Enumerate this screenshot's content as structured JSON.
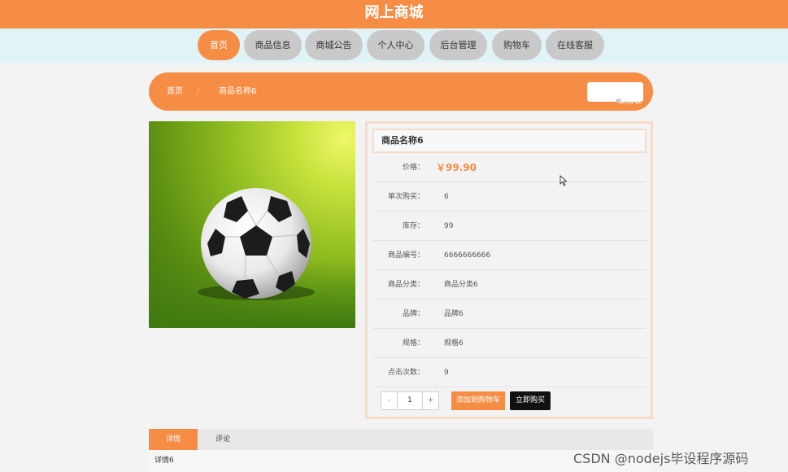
{
  "site": {
    "title": "网上商城"
  },
  "nav": [
    {
      "label": "首页",
      "active": true
    },
    {
      "label": "商品信息"
    },
    {
      "label": "商城公告"
    },
    {
      "label": "个人中心"
    },
    {
      "label": "后台管理"
    },
    {
      "label": "购物车"
    },
    {
      "label": "在线客服"
    }
  ],
  "breadcrumb": {
    "home": "首页",
    "separator": "/",
    "current": "商品名称6"
  },
  "favorite": {
    "label": "取消收藏",
    "icon": "star-icon"
  },
  "product": {
    "name": "商品名称6",
    "image": "soccer-ball",
    "fields": [
      {
        "label": "价格：",
        "value": "￥99.90"
      },
      {
        "label": "单次购买：",
        "value": "6"
      },
      {
        "label": "库存：",
        "value": "99"
      },
      {
        "label": "商品编号：",
        "value": "6666666666"
      },
      {
        "label": "商品分类：",
        "value": "商品分类6"
      },
      {
        "label": "品牌：",
        "value": "品牌6"
      },
      {
        "label": "规格：",
        "value": "规格6"
      },
      {
        "label": "点击次数：",
        "value": "9"
      }
    ]
  },
  "quantity": {
    "minus": "-",
    "value": "1",
    "plus": "+"
  },
  "actions": {
    "add_to_cart": "添加到购物车",
    "buy_now": "立即购买"
  },
  "tabs": [
    {
      "label": "详情",
      "active": true
    },
    {
      "label": "评论"
    }
  ],
  "detail_text": "详情6",
  "watermark": "CSDN @nodejs毕设程序源码",
  "colors": {
    "accent": "#f68d44",
    "nav_bg": "#e0f3f6",
    "page_bg": "#f3f3f3"
  }
}
